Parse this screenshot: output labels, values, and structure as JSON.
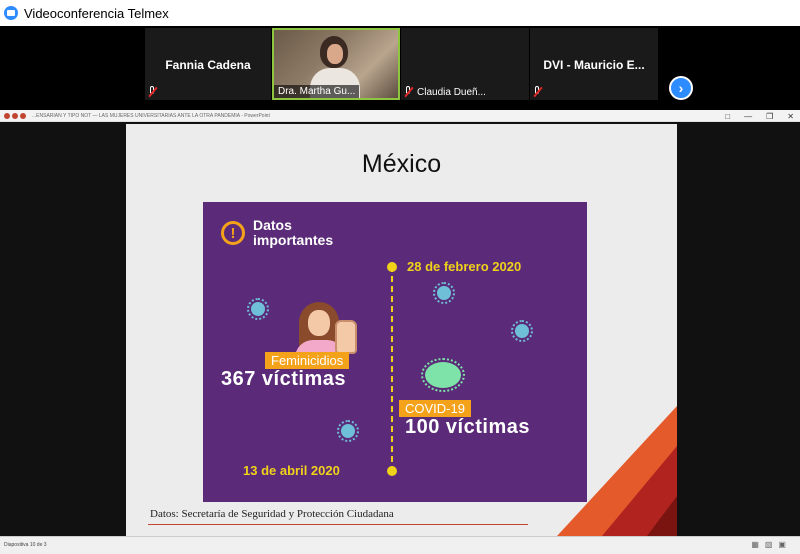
{
  "app": {
    "title": "Videoconferencia Telmex"
  },
  "participants": [
    {
      "name": "Fannia Cadena"
    },
    {
      "name": "Dra. Martha Gu..."
    },
    {
      "name": "Claudia Dueñ..."
    },
    {
      "name": "DVI - Mauricio E..."
    }
  ],
  "ppt_window": {
    "title": "...ENSARIAN Y TIPO NOT — LAS MUJERES UNIVERSITARIAS ANTE LA OTRA PANDEMIA - PowerPoint"
  },
  "slide": {
    "title": "México",
    "graphic": {
      "heading": "Datos importantes",
      "date_start": "28 de febrero 2020",
      "date_end": "13 de abril 2020",
      "femicide_label": "Feminicidios",
      "femicide_value": "367 víctimas",
      "covid_label": "COVID-19",
      "covid_value": "100 víctimas"
    },
    "source": "Datos: Secretaría de Seguridad y Protección Ciudadana"
  },
  "status": {
    "slide_counter": "Diapositiva 10 de 3"
  },
  "colors": {
    "purple": "#5b2a78",
    "yellow": "#f0d21a",
    "orange": "#f5a21b",
    "virus_green": "#7ee3a8",
    "zoom_blue": "#2d8cff"
  }
}
